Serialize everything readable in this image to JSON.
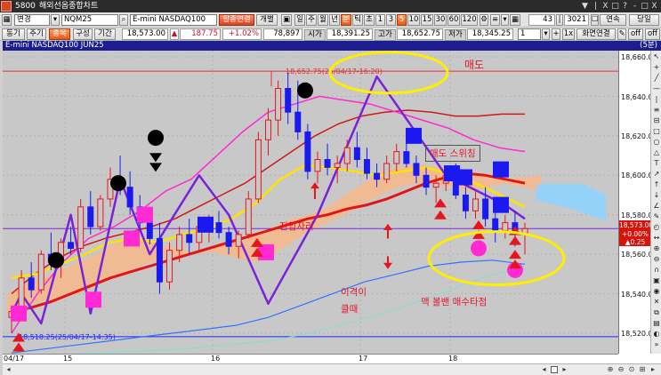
{
  "window": {
    "code": "5800",
    "title": "해외선옵종합차트",
    "controls": [
      "▼",
      "|",
      "X",
      "□",
      "?",
      "-",
      "□",
      "X"
    ]
  },
  "toolbar1": {
    "type_select": "변경",
    "symbol_input": "NQM25",
    "symbol_name": "E-mini NASDAQ100",
    "btn_sync": "할종연결",
    "btn_individual": "개별",
    "period_buttons": [
      "일",
      "주",
      "월",
      "년",
      "분",
      "틱",
      "초",
      "1",
      "3",
      "5",
      "10",
      "15",
      "30",
      "60",
      "120"
    ],
    "active_period": "5",
    "count_value": "43",
    "total_value": "3021",
    "btn_continuous": "연속",
    "btn_current": "당일"
  },
  "toolbar2": {
    "btn_settings": "동기",
    "btn_cycle": "주기",
    "btn_item": "종목",
    "btn_config": "구성",
    "btn_period": "기간",
    "price": "18,573.00",
    "change_sign": "▲",
    "change": "187.75",
    "change_pct": "+1.02%",
    "volume": "78,897",
    "open_label": "시가",
    "open": "18,391.25",
    "high_label": "고가",
    "high": "18,652.75",
    "low_label": "저가",
    "low": "18,345.25",
    "spin_value": "1",
    "btn_zoom": "1x",
    "btn_screen_link": "화면연결",
    "btn_off1": "off",
    "btn_off2": "off"
  },
  "chart_header": {
    "symbol_text": "E-mini NASDAQ100 JUN25",
    "period_text": "(5분)"
  },
  "chart_data": {
    "type": "candlestick",
    "symbol": "E-mini NASDAQ100 JUN25",
    "interval": "5분",
    "ylim": [
      18510,
      18665
    ],
    "y_ticks": [
      18660,
      18640,
      18620,
      18600,
      18580,
      18560,
      18540,
      18520
    ],
    "x_ticks": [
      "04/17",
      "15",
      "16",
      "17",
      "18"
    ],
    "high_line": {
      "value": 18652.75,
      "label": "18,652.75(25/04/17-16:20)"
    },
    "low_line": {
      "value": 18518.25,
      "label": "18,518.25(25/04/17-14:35)"
    },
    "current_price": {
      "price": "18,573.00",
      "pct": "+0.00%",
      "change": "▲0.25"
    },
    "candles": [
      [
        18528,
        18534,
        18520,
        18531
      ],
      [
        18531,
        18552,
        18528,
        18548
      ],
      [
        18548,
        18556,
        18538,
        18542
      ],
      [
        18542,
        18562,
        18540,
        18560
      ],
      [
        18560,
        18571,
        18552,
        18556
      ],
      [
        18556,
        18568,
        18548,
        18566
      ],
      [
        18566,
        18574,
        18560,
        18563
      ],
      [
        18563,
        18588,
        18561,
        18584
      ],
      [
        18584,
        18592,
        18570,
        18574
      ],
      [
        18574,
        18590,
        18572,
        18588
      ],
      [
        18588,
        18604,
        18584,
        18598
      ],
      [
        18598,
        18610,
        18590,
        18594
      ],
      [
        18594,
        18602,
        18580,
        18584
      ],
      [
        18584,
        18590,
        18572,
        18576
      ],
      [
        18576,
        18580,
        18565,
        18568
      ],
      [
        18568,
        18576,
        18540,
        18546
      ],
      [
        18546,
        18566,
        18542,
        18562
      ],
      [
        18562,
        18574,
        18556,
        18570
      ],
      [
        18570,
        18578,
        18560,
        18566
      ],
      [
        18566,
        18576,
        18562,
        18574
      ],
      [
        18574,
        18580,
        18566,
        18576
      ],
      [
        18576,
        18582,
        18568,
        18571
      ],
      [
        18571,
        18574,
        18560,
        18564
      ],
      [
        18564,
        18572,
        18558,
        18570
      ],
      [
        18570,
        18592,
        18568,
        18588
      ],
      [
        18588,
        18622,
        18586,
        18618
      ],
      [
        18618,
        18634,
        18610,
        18628
      ],
      [
        18628,
        18648,
        18620,
        18644
      ],
      [
        18644,
        18652,
        18626,
        18632
      ],
      [
        18632,
        18648,
        18618,
        18622
      ],
      [
        18622,
        18626,
        18598,
        18602
      ],
      [
        18602,
        18612,
        18596,
        18608
      ],
      [
        18608,
        18616,
        18600,
        18604
      ],
      [
        18604,
        18610,
        18596,
        18606
      ],
      [
        18606,
        18618,
        18602,
        18614
      ],
      [
        18614,
        18622,
        18604,
        18608
      ],
      [
        18608,
        18614,
        18598,
        18601
      ],
      [
        18601,
        18606,
        18594,
        18598
      ],
      [
        18598,
        18610,
        18596,
        18606
      ],
      [
        18606,
        18616,
        18602,
        18612
      ],
      [
        18612,
        18618,
        18604,
        18606
      ],
      [
        18606,
        18610,
        18596,
        18600
      ],
      [
        18600,
        18604,
        18590,
        18594
      ],
      [
        18594,
        18600,
        18586,
        18596
      ],
      [
        18596,
        18604,
        18592,
        18600
      ],
      [
        18600,
        18606,
        18588,
        18590
      ],
      [
        18590,
        18594,
        18578,
        18582
      ],
      [
        18582,
        18592,
        18578,
        18588
      ],
      [
        18588,
        18594,
        18574,
        18578
      ],
      [
        18578,
        18584,
        18566,
        18572
      ],
      [
        18572,
        18580,
        18568,
        18576
      ],
      [
        18576,
        18582,
        18564,
        18570
      ],
      [
        18570,
        18576,
        18560,
        18573
      ]
    ]
  },
  "annotations": {
    "sell": "매도",
    "sell_switch": "매도 스위칭",
    "entry_zone": "진입자리",
    "gap_line1": "이격이",
    "gap_line2": "클때",
    "bb_buy": "맥 볼밴 매수타점"
  },
  "colors": {
    "chart_bg": "#c8c8c8",
    "up": "#e5161b",
    "down": "#1a1af0",
    "ichimoku_cloud": "#f7b98a",
    "ma_red": "#e31414",
    "ma_yellow": "#ffe200",
    "ma_purple": "#7a22d8",
    "ma_magenta": "#ff2ad4",
    "bb_blue": "#2f74ff",
    "annotation_yellow": "#ffee00",
    "annotation_text": "#e4142e"
  }
}
